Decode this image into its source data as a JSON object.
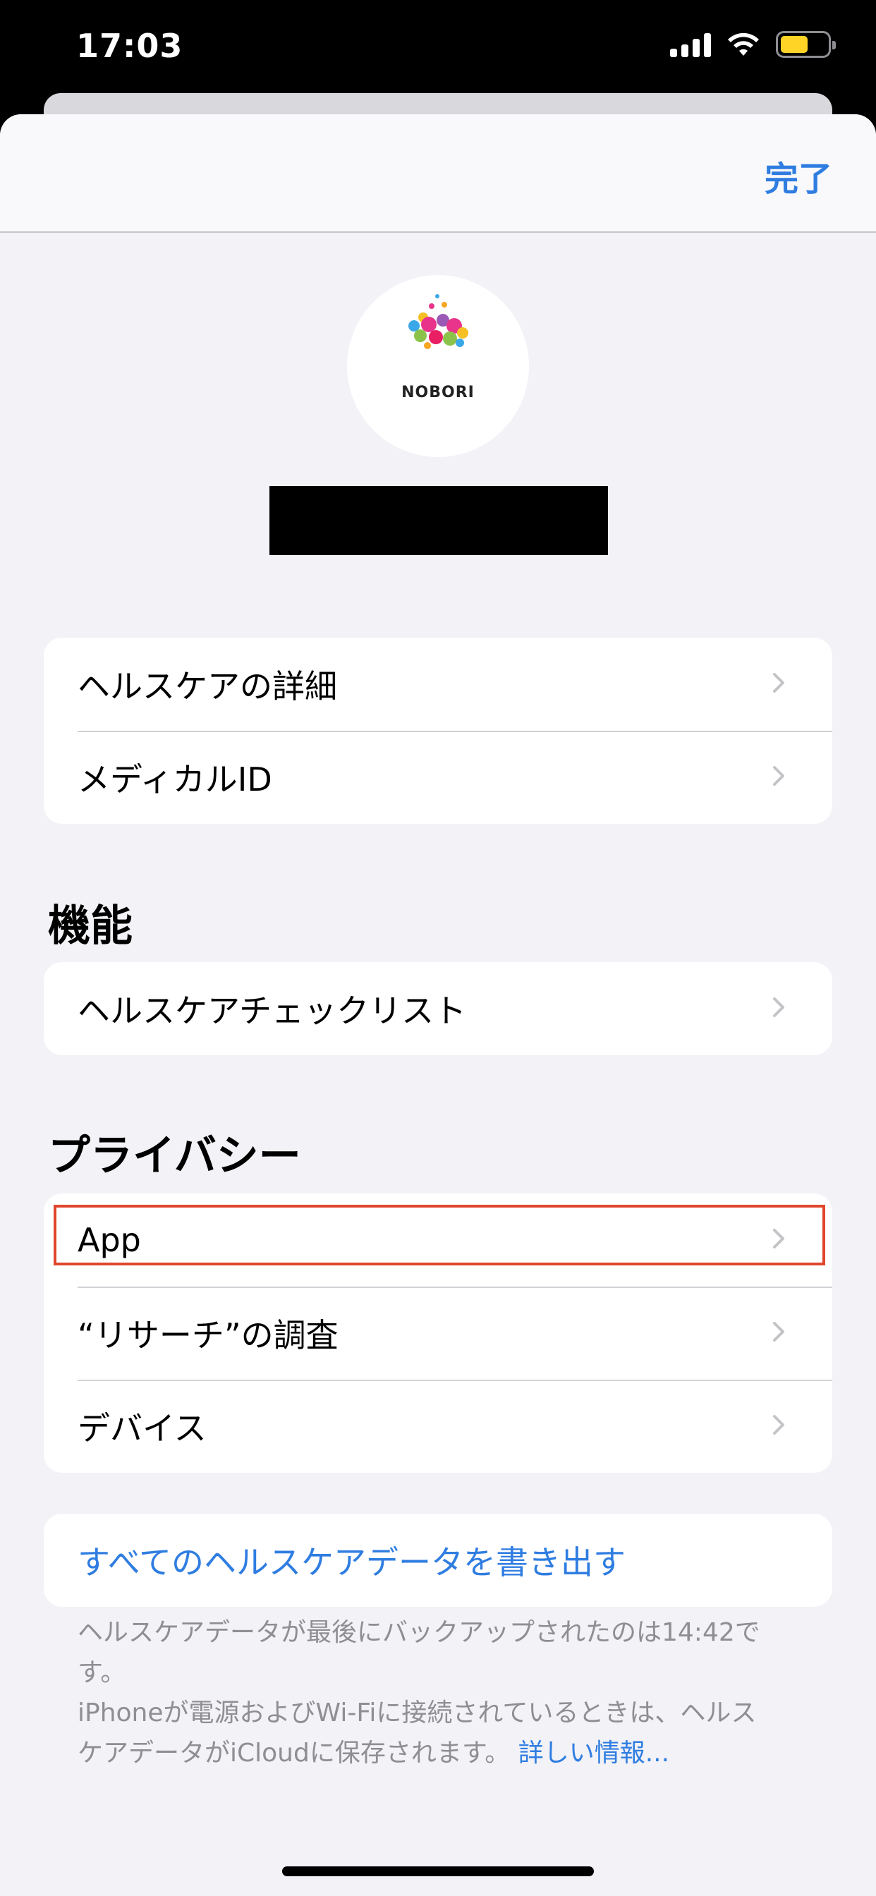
{
  "status_bar": {
    "time": "17:03",
    "battery_color": "#ffd426"
  },
  "nav": {
    "done_label": "完了"
  },
  "profile": {
    "logo_text": "NOBORI"
  },
  "group1": {
    "items": [
      {
        "label": "ヘルスケアの詳細"
      },
      {
        "label": "メディカルID"
      }
    ]
  },
  "features": {
    "header": "機能",
    "items": [
      {
        "label": "ヘルスケアチェックリスト"
      }
    ]
  },
  "privacy": {
    "header": "プライバシー",
    "items": [
      {
        "label": "App"
      },
      {
        "label": "“リサーチ”の調査"
      },
      {
        "label": "デバイス"
      }
    ]
  },
  "export": {
    "label": "すべてのヘルスケアデータを書き出す"
  },
  "footer": {
    "line1": "ヘルスケアデータが最後にバックアップされたのは14:42です。",
    "line2": "iPhoneが電源およびWi-Fiに接続されているときは、ヘルスケアデータがiCloudに保存されます。",
    "link": "詳しい情報..."
  },
  "colors": {
    "accent": "#2f7de1",
    "highlight": "#e0462c",
    "background": "#f2f2f7"
  }
}
